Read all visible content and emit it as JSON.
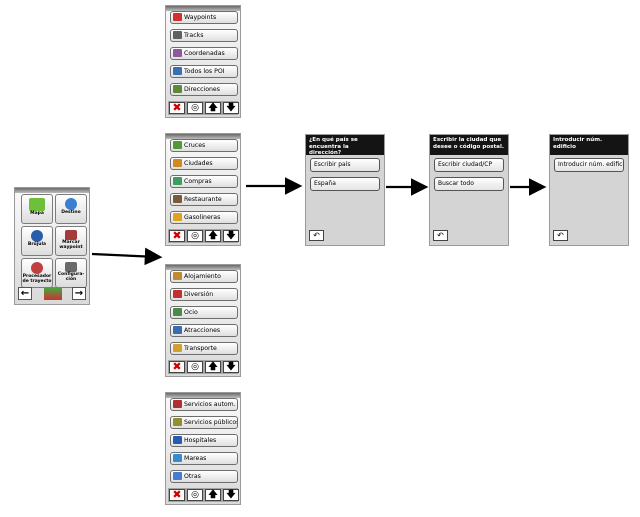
{
  "main_menu": {
    "tiles": [
      {
        "label": "Mapa",
        "color": "#6fbf3a"
      },
      {
        "label": "Destino",
        "color": "#3a7fd0"
      },
      {
        "label": "Brújula",
        "color": "#2b5cab"
      },
      {
        "label": "Marcar waypoint",
        "color": "#a33b3b"
      },
      {
        "label": "Procesador de trayecto",
        "color": "#c04040"
      },
      {
        "label": "Configura-ción",
        "color": "#6a6a6a"
      }
    ],
    "left_arrow": "←",
    "right_arrow": "→"
  },
  "toolbar": {
    "delete": "✖",
    "target": "◎",
    "up": "🡅",
    "down": "🡇"
  },
  "lists": [
    {
      "items": [
        {
          "label": "Waypoints",
          "color": "#d03030"
        },
        {
          "label": "Tracks",
          "color": "#606060"
        },
        {
          "label": "Coordenadas",
          "color": "#8a5a9a"
        },
        {
          "label": "Todos los POI",
          "color": "#3a6fb0"
        },
        {
          "label": "Direcciones",
          "color": "#5a8a3a"
        }
      ]
    },
    {
      "items": [
        {
          "label": "Cruces",
          "color": "#4d9a3a"
        },
        {
          "label": "Ciudades",
          "color": "#d08a20"
        },
        {
          "label": "Compras",
          "color": "#3aa05a"
        },
        {
          "label": "Restaurante",
          "color": "#7a5a3a"
        },
        {
          "label": "Gasolineras",
          "color": "#e0a020"
        }
      ]
    },
    {
      "items": [
        {
          "label": "Alojamiento",
          "color": "#c08a30"
        },
        {
          "label": "Diversión",
          "color": "#c03030"
        },
        {
          "label": "Ocio",
          "color": "#4a8a4a"
        },
        {
          "label": "Atracciones",
          "color": "#3a6ab0"
        },
        {
          "label": "Transporte",
          "color": "#d0a030"
        }
      ]
    },
    {
      "items": [
        {
          "label": "Servicios autom.",
          "color": "#b03030"
        },
        {
          "label": "Servicios públicos",
          "color": "#909030"
        },
        {
          "label": "Hospitales",
          "color": "#2a5ab0"
        },
        {
          "label": "Mareas",
          "color": "#3a8ad0"
        },
        {
          "label": "Otras",
          "color": "#4a7ad0"
        }
      ]
    }
  ],
  "dialogs": [
    {
      "header": "¿En qué país se encuentra la dirección?",
      "fields": [
        "Escribir país",
        "España"
      ],
      "back": "↶"
    },
    {
      "header": "Escribir la ciudad que desee o código postal.",
      "fields": [
        "Escribir ciudad/CP",
        "Buscar todo"
      ],
      "back": "↶"
    },
    {
      "header": "Introducir núm. edificio",
      "fields": [
        "Introducir núm. edifici"
      ],
      "back": "↶"
    }
  ]
}
